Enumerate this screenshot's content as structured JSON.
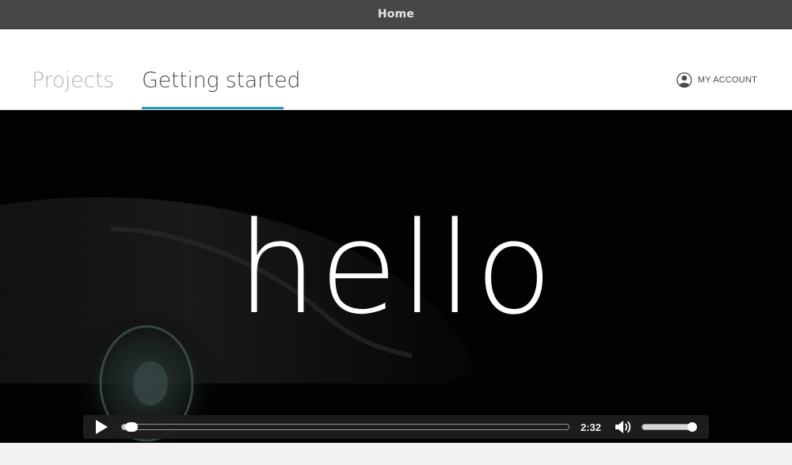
{
  "window": {
    "title": "Home"
  },
  "nav": {
    "tabs": [
      {
        "label": "Projects",
        "active": false
      },
      {
        "label": "Getting started",
        "active": true
      }
    ],
    "accent_color": "#2196b3",
    "account": {
      "icon": "user-circle-icon",
      "label": "MY ACCOUNT"
    }
  },
  "video": {
    "overlay_text": "hello",
    "controls": {
      "play_icon": "play-icon",
      "progress": 0.02,
      "time": "2:32",
      "volume_icon": "volume-icon",
      "volume_level": 0.92
    }
  }
}
